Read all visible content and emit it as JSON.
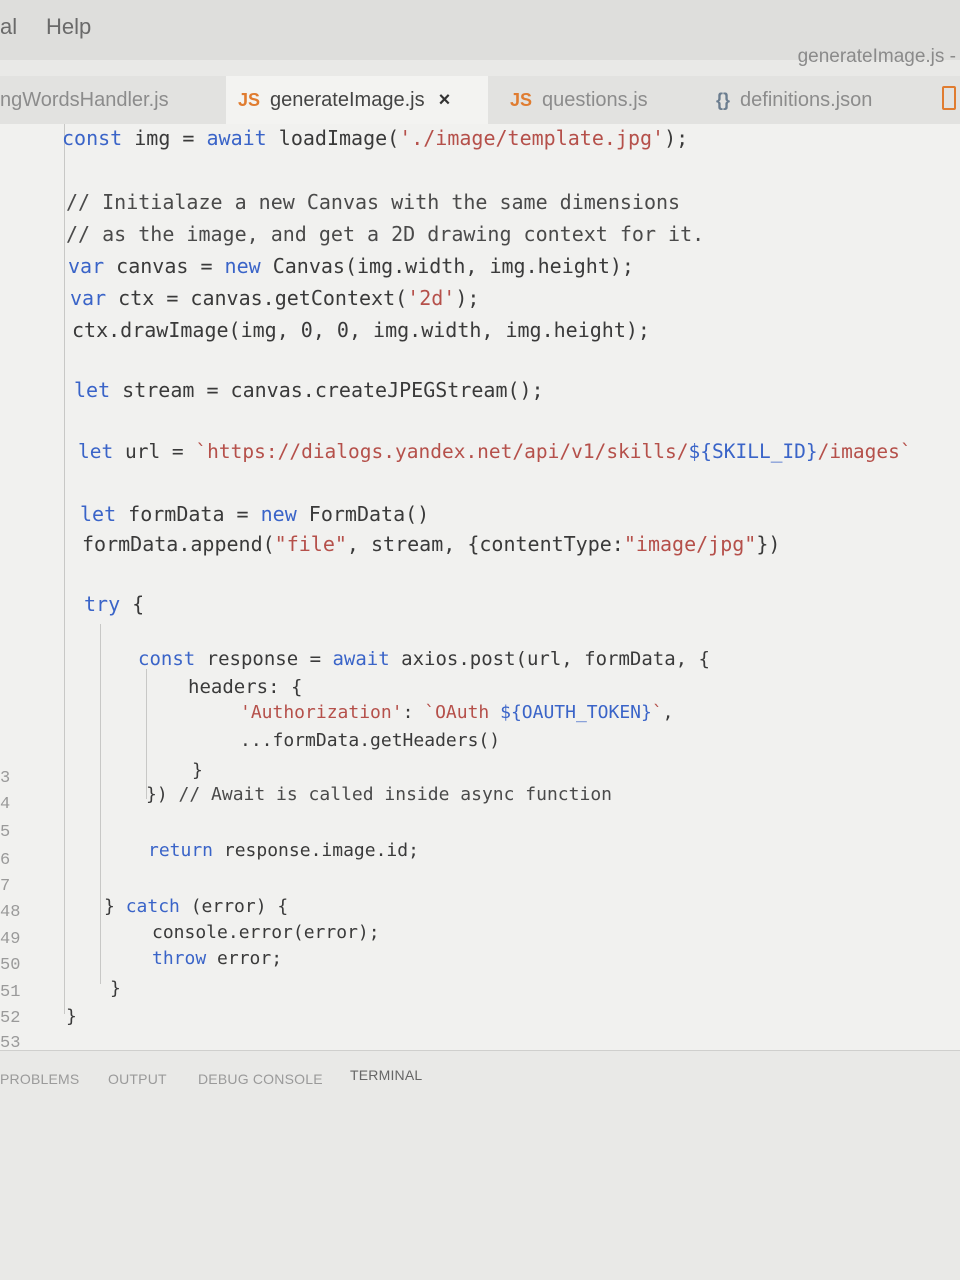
{
  "menubar": {
    "items": [
      "al",
      "Help"
    ]
  },
  "window_title": "generateImage.js -",
  "tabs": [
    {
      "label": "ngWordsHandler.js",
      "active": false
    },
    {
      "label": "generateImage.js",
      "active": true,
      "close": "×"
    },
    {
      "label": "questions.js",
      "active": false
    },
    {
      "label": "definitions.json",
      "active": false
    }
  ],
  "gutter": [
    "3",
    "4",
    "5",
    "6",
    "7",
    "48",
    "49",
    "50",
    "51",
    "52",
    "53"
  ],
  "code": {
    "l1": [
      "const",
      " img = ",
      "await",
      " loadImage(",
      "'./image/template.jpg'",
      ");"
    ],
    "l2": "// Initialaze a new Canvas with the same dimensions",
    "l3": "// as the image, and get a 2D drawing context for it.",
    "l4": [
      "var",
      " canvas = ",
      "new",
      " Canvas(img.width, img.height);"
    ],
    "l5": [
      "var",
      " ctx = canvas.getContext(",
      "'2d'",
      ");"
    ],
    "l6": "ctx.drawImage(img, 0, 0, img.width, img.height);",
    "l7": [
      "let",
      " stream = canvas.createJPEGStream();"
    ],
    "l8": [
      "let",
      " url = ",
      "`https://dialogs.yandex.net/api/v1/skills/",
      "${SKILL_ID}",
      "/images`"
    ],
    "l9": [
      "let",
      " formData = ",
      "new",
      " FormData()"
    ],
    "l10": [
      "formData.append(",
      "\"file\"",
      ", stream, {contentType:",
      "\"image/jpg\"",
      "})"
    ],
    "l11": [
      "try",
      " {"
    ],
    "l12": [
      "const",
      " response = ",
      "await",
      " axios.post(url, formData, {"
    ],
    "l13": "headers: {",
    "l14": [
      "'Authorization'",
      ": ",
      "`OAuth ",
      "${OAUTH_TOKEN}",
      "`",
      ","
    ],
    "l15": "...formData.getHeaders()",
    "l16": "}",
    "l17": [
      "}) ",
      "// Await is called inside async function"
    ],
    "l18": [
      "return",
      " response.image.id;"
    ],
    "l19": [
      "} ",
      "catch",
      " (error) {"
    ],
    "l20": "console.error(error);",
    "l21": [
      "throw",
      " error;"
    ],
    "l22": "}",
    "l23": "}"
  },
  "panel_tabs": [
    "PROBLEMS",
    "OUTPUT",
    "DEBUG CONSOLE",
    "TERMINAL"
  ]
}
